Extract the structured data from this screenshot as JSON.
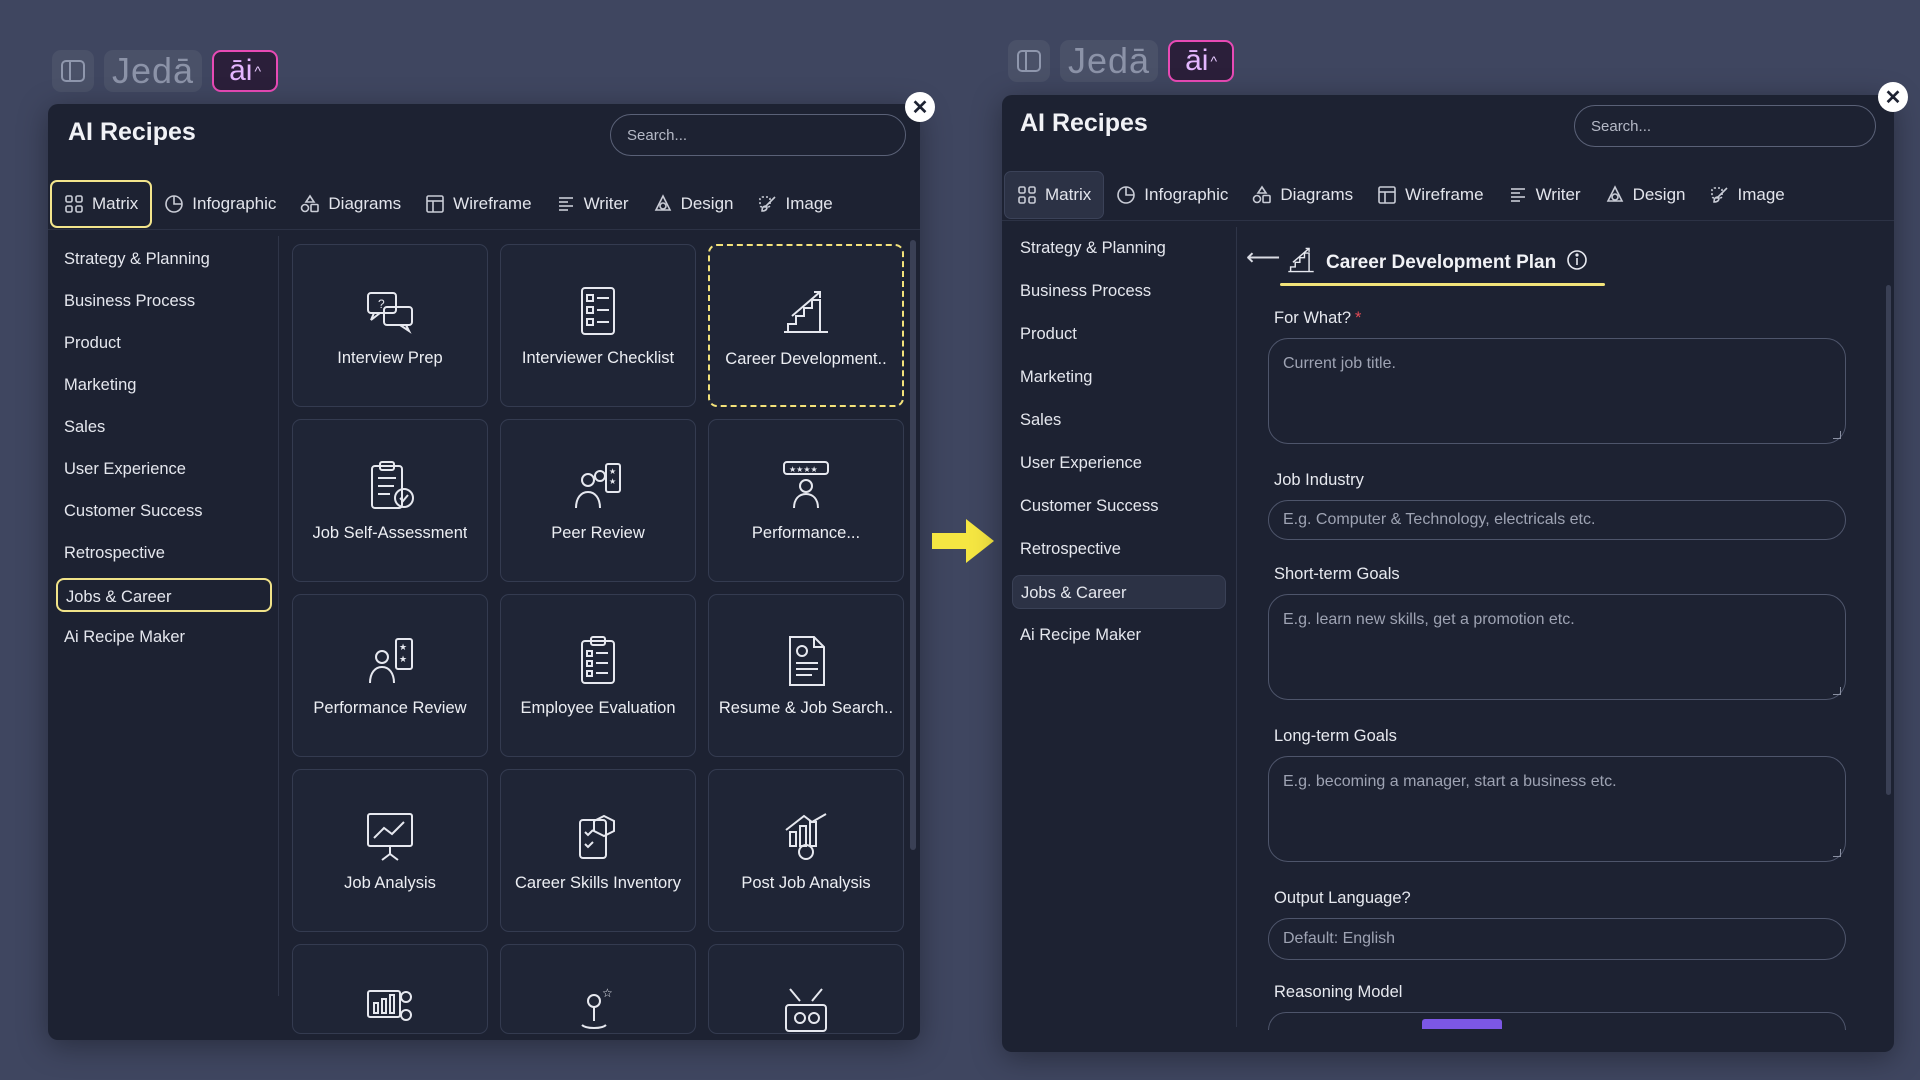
{
  "colors": {
    "background": "#3f4660",
    "panel": "#1d2232",
    "highlight": "#f3e27a",
    "ai_accent": "#e84ab5",
    "badge": "#7c57e5",
    "required": "#e24b55"
  },
  "toolbar": {
    "brand": "Jedā",
    "ai_label": "āi"
  },
  "left": {
    "title": "AI Recipes",
    "search_placeholder": "Search...",
    "tabs": [
      {
        "label": "Matrix",
        "icon": "grid-icon"
      },
      {
        "label": "Infographic",
        "icon": "pie-chart-icon"
      },
      {
        "label": "Diagrams",
        "icon": "shapes-icon"
      },
      {
        "label": "Wireframe",
        "icon": "layout-icon"
      },
      {
        "label": "Writer",
        "icon": "text-icon"
      },
      {
        "label": "Design",
        "icon": "design-icon"
      },
      {
        "label": "Image",
        "icon": "brush-icon"
      }
    ],
    "categories": [
      "Strategy & Planning",
      "Business Process",
      "Product",
      "Marketing",
      "Sales",
      "User Experience",
      "Customer Success",
      "Retrospective",
      "Jobs & Career",
      "Ai Recipe Maker"
    ],
    "selected_category": "Jobs & Career",
    "cards": [
      {
        "label": "Interview Prep",
        "icon": "chat-bubbles-icon"
      },
      {
        "label": "Interviewer Checklist",
        "icon": "checklist-icon"
      },
      {
        "label": "Career Development..",
        "icon": "growth-stairs-icon"
      },
      {
        "label": "Job Self-Assessment",
        "icon": "clipboard-check-icon"
      },
      {
        "label": "Peer Review",
        "icon": "peer-review-icon"
      },
      {
        "label": "Performance...",
        "icon": "rating-person-icon"
      },
      {
        "label": "Performance Review",
        "icon": "person-stars-icon"
      },
      {
        "label": "Employee Evaluation",
        "icon": "evaluation-clipboard-icon"
      },
      {
        "label": "Resume & Job Search..",
        "icon": "resume-icon"
      },
      {
        "label": "Job Analysis",
        "icon": "presentation-chart-icon"
      },
      {
        "label": "Career Skills Inventory",
        "icon": "skills-box-icon"
      },
      {
        "label": "Post Job Analysis",
        "icon": "chart-gear-icon"
      },
      {
        "label": "",
        "icon": "team-chart-icon"
      },
      {
        "label": "",
        "icon": "person-star-icon"
      },
      {
        "label": "",
        "icon": "tools-box-icon"
      }
    ]
  },
  "right": {
    "title": "AI Recipes",
    "search_placeholder": "Search...",
    "form_title": "Career Development Plan",
    "fields": [
      {
        "label": "For What?",
        "required": true,
        "placeholder": "Current job title.",
        "type": "textarea"
      },
      {
        "label": "Job Industry",
        "required": false,
        "placeholder": "E.g. Computer & Technology, electricals etc.",
        "type": "input"
      },
      {
        "label": "Short-term Goals",
        "required": false,
        "placeholder": "E.g. learn new skills, get a promotion etc.",
        "type": "textarea"
      },
      {
        "label": "Long-term Goals",
        "required": false,
        "placeholder": "E.g. becoming a manager, start a business etc.",
        "type": "textarea"
      },
      {
        "label": "Output Language?",
        "required": false,
        "placeholder": "Default: English",
        "type": "input"
      },
      {
        "label": "Reasoning Model",
        "required": false,
        "placeholder": "",
        "type": "select"
      }
    ]
  }
}
